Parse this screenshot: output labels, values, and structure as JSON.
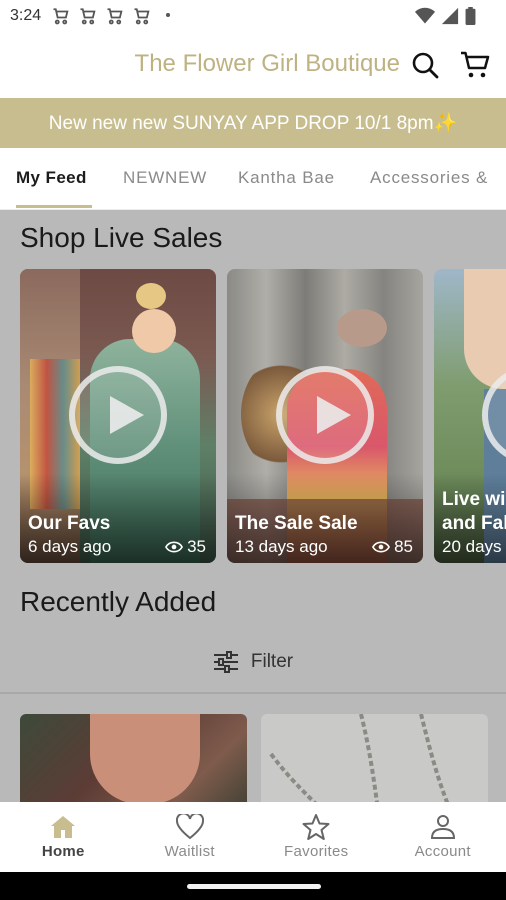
{
  "status_bar": {
    "time": "3:24",
    "notification_icons": [
      "cart-icon",
      "cart-icon",
      "cart-icon",
      "cart-icon"
    ],
    "right_icons": [
      "wifi-icon",
      "signal-icon",
      "battery-icon"
    ]
  },
  "header": {
    "store_name": "The Flower Girl Boutique",
    "icons": [
      "search-icon",
      "cart-icon"
    ],
    "brand_color": "#c8bd8e"
  },
  "banner": {
    "text": "New new new SUNYAY APP DROP 10/1 8pm✨"
  },
  "tabs": {
    "items": [
      {
        "label": "My Feed",
        "active": true
      },
      {
        "label": "NEWNEW",
        "active": false
      },
      {
        "label": "Kantha Bae",
        "active": false
      },
      {
        "label": "Accessories &",
        "active": false
      }
    ]
  },
  "live_sales": {
    "title": "Shop Live Sales",
    "cards": [
      {
        "title": "Our Favs",
        "time": "6 days ago",
        "views": "35"
      },
      {
        "title": "The Sale Sale",
        "time": "13 days ago",
        "views": "85"
      },
      {
        "title": "Live wi",
        "title2": "and Fal",
        "time": "20 days"
      }
    ]
  },
  "recently_added": {
    "title": "Recently Added",
    "filter_label": "Filter"
  },
  "bottom_nav": {
    "items": [
      {
        "label": "Home",
        "icon": "home-icon",
        "active": true
      },
      {
        "label": "Waitlist",
        "icon": "heart-icon",
        "active": false
      },
      {
        "label": "Favorites",
        "icon": "star-icon",
        "active": false
      },
      {
        "label": "Account",
        "icon": "person-icon",
        "active": false
      }
    ]
  }
}
